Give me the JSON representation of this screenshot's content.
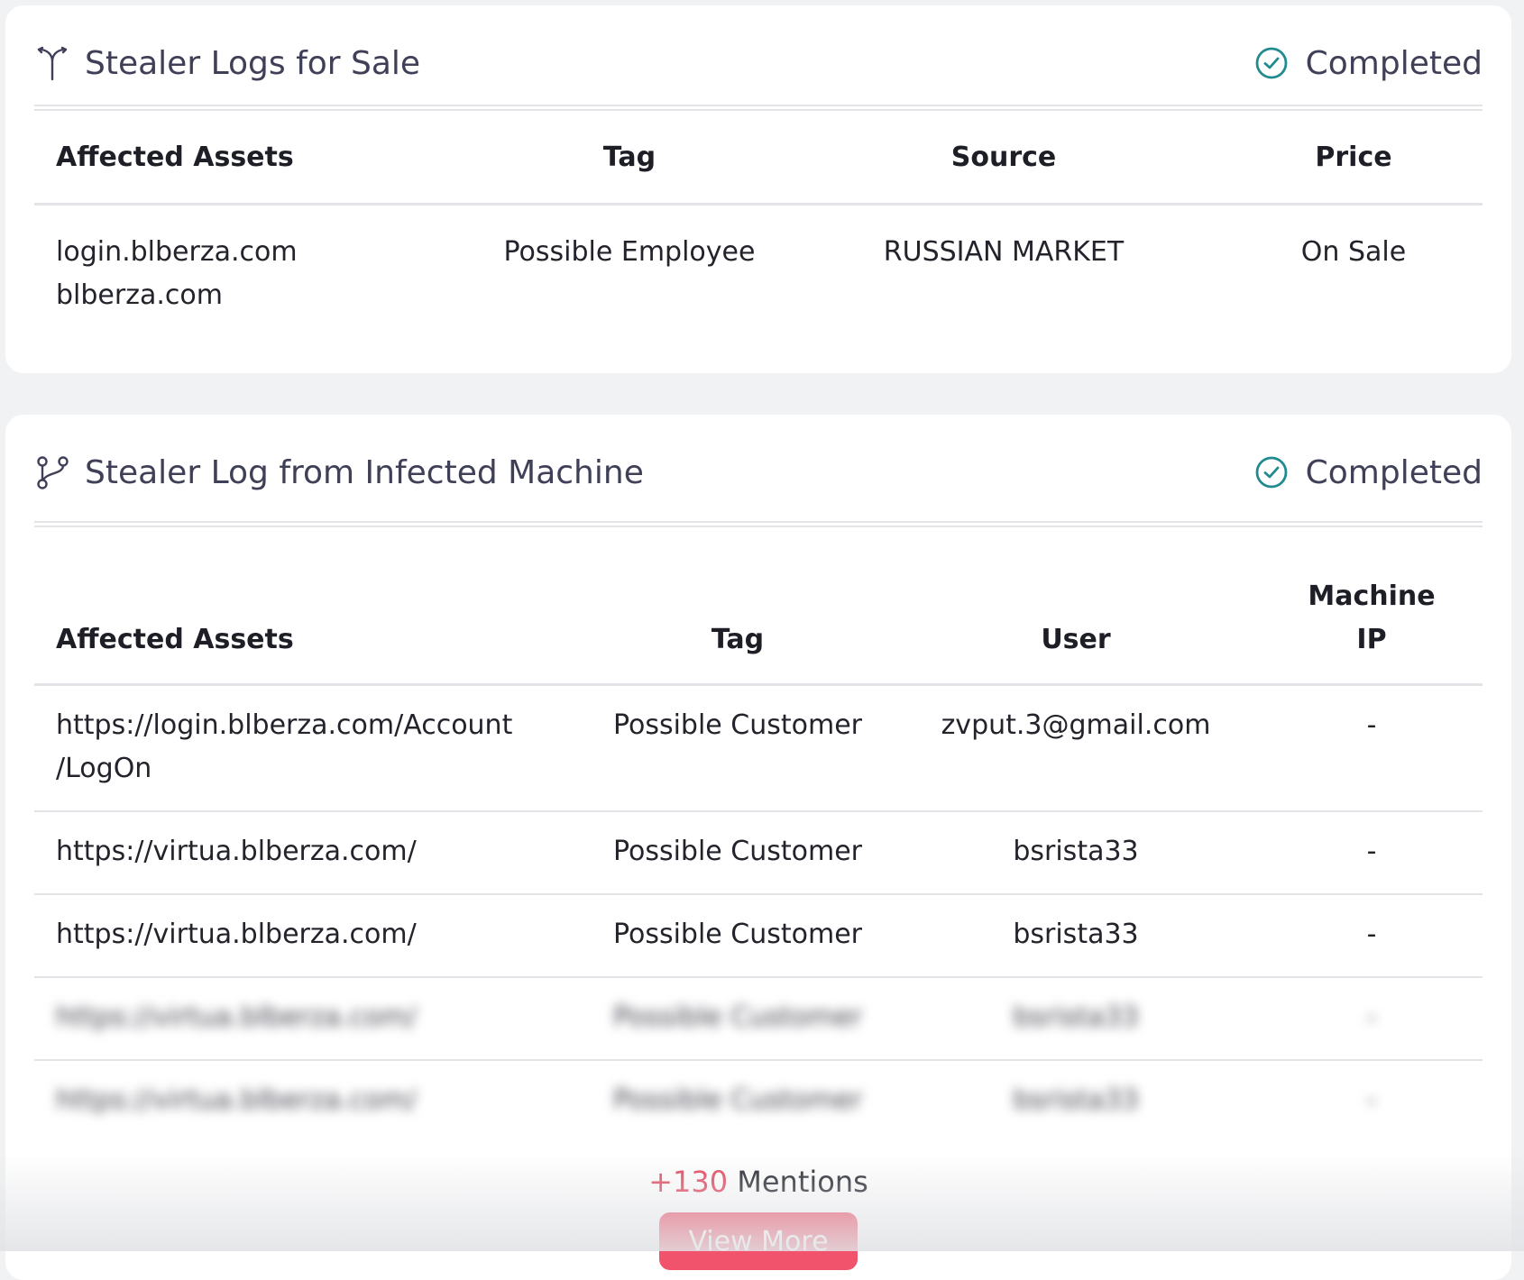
{
  "card1": {
    "title": "Stealer Logs for Sale",
    "icon": "split-icon",
    "status": "Completed",
    "columns": [
      "Affected Assets",
      "Tag",
      "Source",
      "Price"
    ],
    "row": {
      "asset_line1": "login.blberza.com",
      "asset_line2": "blberza.com",
      "tag": "Possible Employee",
      "source": "RUSSIAN MARKET",
      "price": "On Sale"
    }
  },
  "card2": {
    "title": "Stealer Log from Infected Machine",
    "icon": "branch-icon",
    "status": "Completed",
    "columns": [
      "Affected Assets",
      "Tag",
      "User",
      "Machine",
      "IP"
    ],
    "rows": [
      {
        "asset_line1": "https://login.blberza.com/Account",
        "asset_line2": "/LogOn",
        "tag": "Possible Customer",
        "user": "zvput.3@gmail.com",
        "ip": "-"
      },
      {
        "asset_line1": "https://virtua.blberza.com/",
        "tag": "Possible Customer",
        "user": "bsrista33",
        "ip": "-"
      },
      {
        "asset_line1": "https://virtua.blberza.com/",
        "tag": "Possible Customer",
        "user": "bsrista33",
        "ip": "-"
      },
      {
        "asset_line1": "https://virtua.blberza.com/",
        "tag": "Possible Customer",
        "user": "bsrista33",
        "ip": "-"
      },
      {
        "asset_line1": "https://virtua.blberza.com/",
        "tag": "Possible Customer",
        "user": "bsrista33",
        "ip": "-"
      }
    ],
    "mentions_count": "+130",
    "mentions_label": "Mentions",
    "view_more": "View More"
  },
  "colors": {
    "accent_teal": "#1f8a8f",
    "button_red": "#f0536b",
    "count_red": "#e2445c"
  }
}
